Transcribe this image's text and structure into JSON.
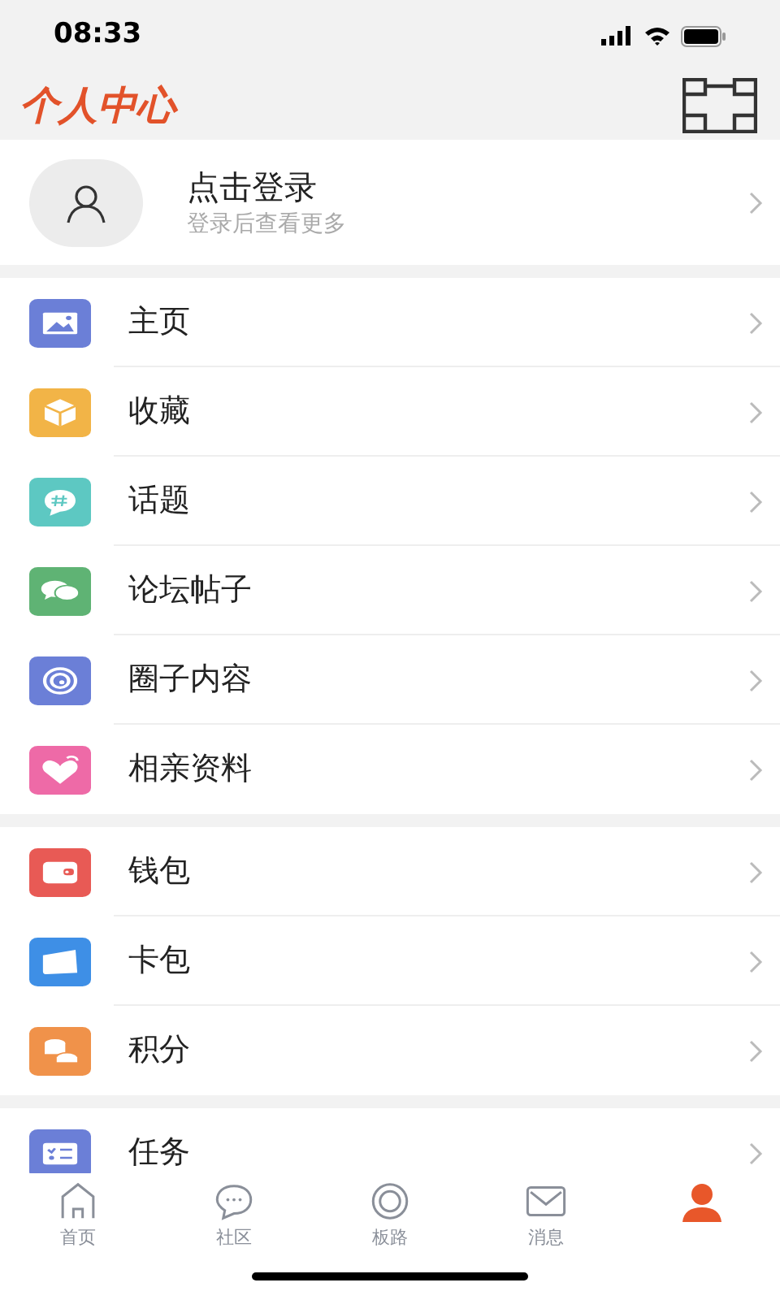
{
  "status_bar": {
    "time": "08:33"
  },
  "header": {
    "title": "个人中心"
  },
  "login": {
    "title": "点击登录",
    "subtitle": "登录后查看更多"
  },
  "menu_groups": [
    {
      "items": [
        {
          "label": "主页",
          "kind": "picture",
          "color": "#6b7fd7"
        },
        {
          "label": "收藏",
          "kind": "box",
          "color": "#f2b447"
        },
        {
          "label": "话题",
          "kind": "topic",
          "color": "#5dc8c2"
        },
        {
          "label": "论坛帖子",
          "kind": "chat",
          "color": "#5fb374"
        },
        {
          "label": "圈子内容",
          "kind": "swirl",
          "color": "#6b7fd7"
        },
        {
          "label": "相亲资料",
          "kind": "heart",
          "color": "#ee6aa7"
        }
      ]
    },
    {
      "items": [
        {
          "label": "钱包",
          "kind": "wallet",
          "color": "#e85a55"
        },
        {
          "label": "卡包",
          "kind": "card",
          "color": "#3e8fe6"
        },
        {
          "label": "积分",
          "kind": "coins",
          "color": "#f0924a"
        }
      ]
    },
    {
      "items": [
        {
          "label": "任务",
          "kind": "task",
          "color": "#6b7fd7"
        }
      ]
    }
  ],
  "tabs": [
    {
      "label": "首页",
      "kind": "home",
      "selected": false
    },
    {
      "label": "社区",
      "kind": "chat",
      "selected": false
    },
    {
      "label": "板路",
      "kind": "ring",
      "selected": false
    },
    {
      "label": "消息",
      "kind": "mail",
      "selected": false
    },
    {
      "kind": "person",
      "selected": true
    }
  ]
}
